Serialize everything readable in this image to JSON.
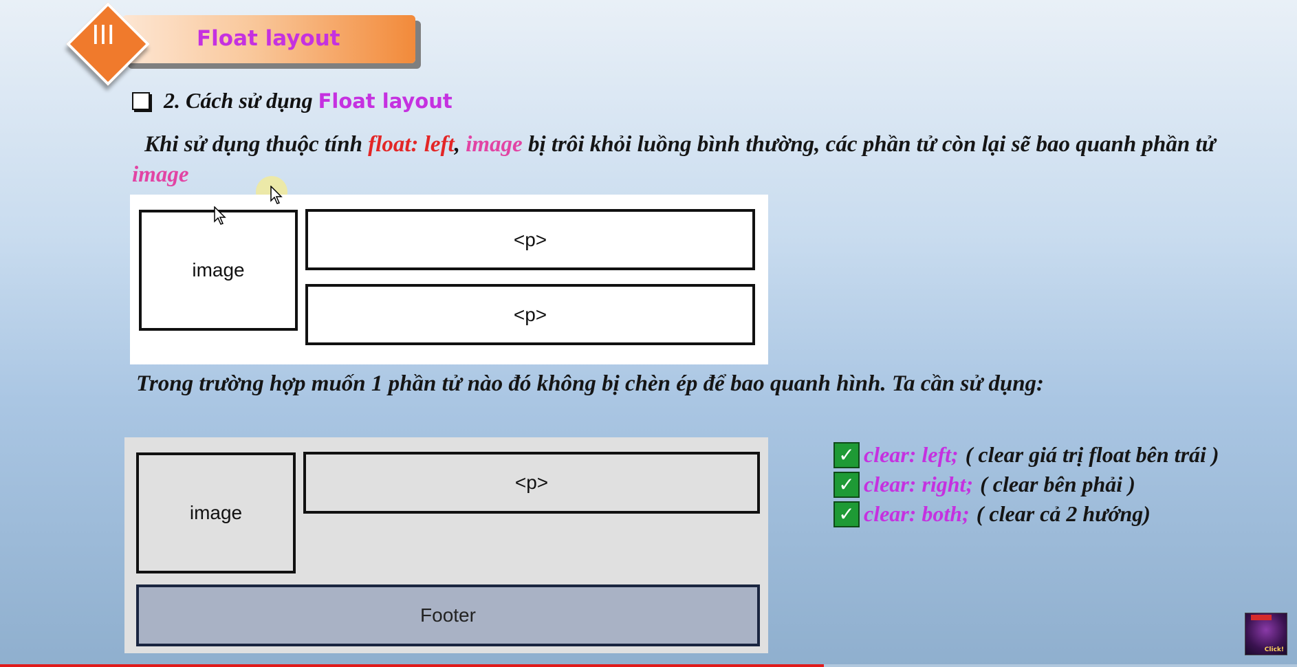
{
  "header": {
    "number": "III",
    "title": "Float layout"
  },
  "section": {
    "heading_prefix": "2. Cách sử dụng",
    "heading_accent": "Float layout"
  },
  "paragraph1": {
    "part1": "Khi sử dụng thuộc tính",
    "float_left": "float: left",
    "comma": ",",
    "image_word": "image",
    "part2": "bị trôi khỏi luồng bình thường, các phần tử còn lại sẽ bao quanh phần tử",
    "image_word_2": "image"
  },
  "diagram1": {
    "image_label": "image",
    "p1_label": "<p>",
    "p2_label": "<p>"
  },
  "paragraph2": {
    "text": "Trong trường hợp muốn 1 phần tử nào đó không bị chèn ép để bao quanh hình. Ta cần sử dụng:"
  },
  "diagram2": {
    "image_label": "image",
    "p_label": "<p>",
    "footer_label": "Footer"
  },
  "clear_options": [
    {
      "code": "clear: left;",
      "desc": "( clear giá trị float bên trái )"
    },
    {
      "code": "clear: right;",
      "desc": "( clear bên phải )"
    },
    {
      "code": "clear: both;",
      "desc": "( clear cả 2 hướng)"
    }
  ],
  "thumbnail": {
    "label": "Click!"
  },
  "video_progress": 0.635,
  "colors": {
    "accent_purple": "#c531e0",
    "accent_red": "#e32626",
    "accent_pink": "#e244a4",
    "header_orange": "#f07a2c",
    "check_green": "#1e9a35",
    "progress_red": "#e01b1b"
  }
}
